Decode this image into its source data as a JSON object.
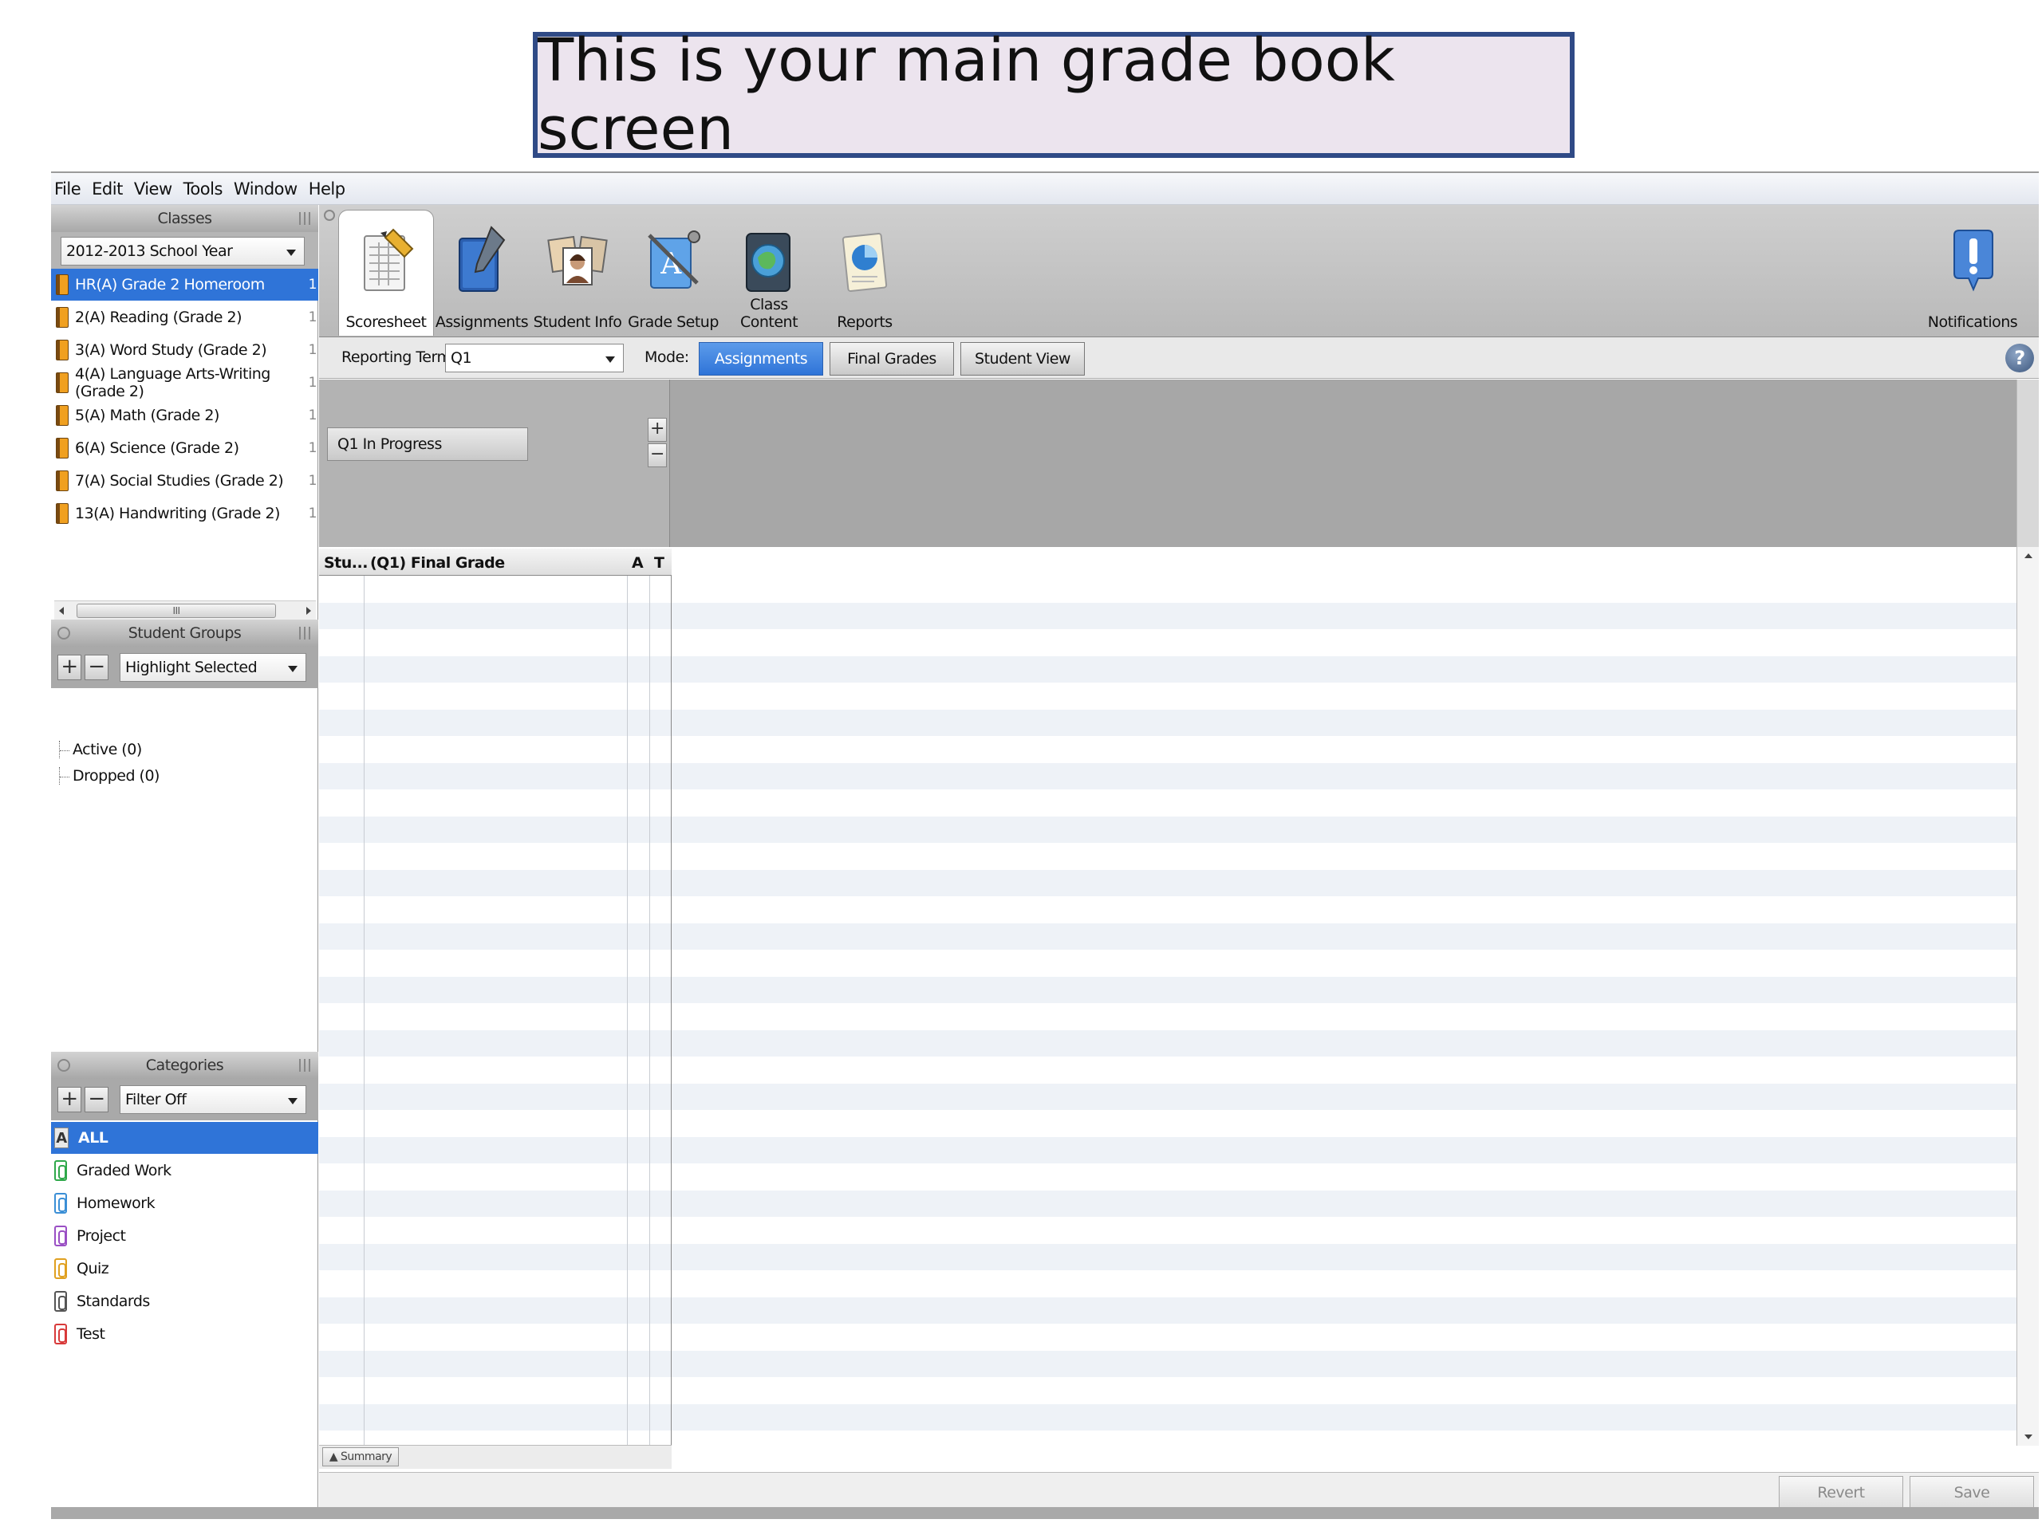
{
  "caption": "This is your main grade book screen",
  "menu": [
    "File",
    "Edit",
    "View",
    "Tools",
    "Window",
    "Help"
  ],
  "classes_panel": {
    "title": "Classes",
    "year_select": "2012-2013 School Year",
    "items": [
      {
        "label": "HR(A) Grade 2 Homeroom",
        "count": "1",
        "selected": true
      },
      {
        "label": "2(A) Reading (Grade 2)",
        "count": "1"
      },
      {
        "label": "3(A) Word Study (Grade 2)",
        "count": "1"
      },
      {
        "label": "4(A) Language Arts-Writing (Grade 2)",
        "count": "1"
      },
      {
        "label": "5(A) Math (Grade 2)",
        "count": "1"
      },
      {
        "label": "6(A) Science (Grade 2)",
        "count": "1"
      },
      {
        "label": "7(A) Social Studies (Grade 2)",
        "count": "1"
      },
      {
        "label": "13(A) Handwriting (Grade 2)",
        "count": "1"
      }
    ]
  },
  "groups_panel": {
    "title": "Student Groups",
    "select": "Highlight Selected",
    "items": [
      "Active (0)",
      "Dropped (0)"
    ]
  },
  "categories_panel": {
    "title": "Categories",
    "select": "Filter Off",
    "items": [
      {
        "label": "ALL",
        "selected": true,
        "color": "#555555"
      },
      {
        "label": "Graded Work",
        "color": "#2fa84a"
      },
      {
        "label": "Homework",
        "color": "#3b8fd6"
      },
      {
        "label": "Project",
        "color": "#9a4fc4"
      },
      {
        "label": "Quiz",
        "color": "#e0a020"
      },
      {
        "label": "Standards",
        "color": "#555555"
      },
      {
        "label": "Test",
        "color": "#d83a3a"
      }
    ]
  },
  "toolbar": {
    "tools": [
      "Scoresheet",
      "Assignments",
      "Student Info",
      "Grade Setup",
      "Class Content",
      "Reports"
    ],
    "notifications": "Notifications"
  },
  "modebar": {
    "term_label": "Reporting Term:",
    "term_value": "Q1",
    "mode_label": "Mode:",
    "modes": [
      "Assignments",
      "Final Grades",
      "Student View"
    ],
    "active_mode": "Assignments",
    "help": "?"
  },
  "grid": {
    "term_chip": "Q1 In Progress",
    "columns": [
      "Stu...",
      "(Q1) Final Grade",
      "A",
      "T"
    ],
    "summary_tab": "Summary"
  },
  "footer": {
    "revert": "Revert",
    "save": "Save"
  },
  "colors": {
    "selection": "#2f74d8",
    "toolbar": "#bdbdbd"
  }
}
